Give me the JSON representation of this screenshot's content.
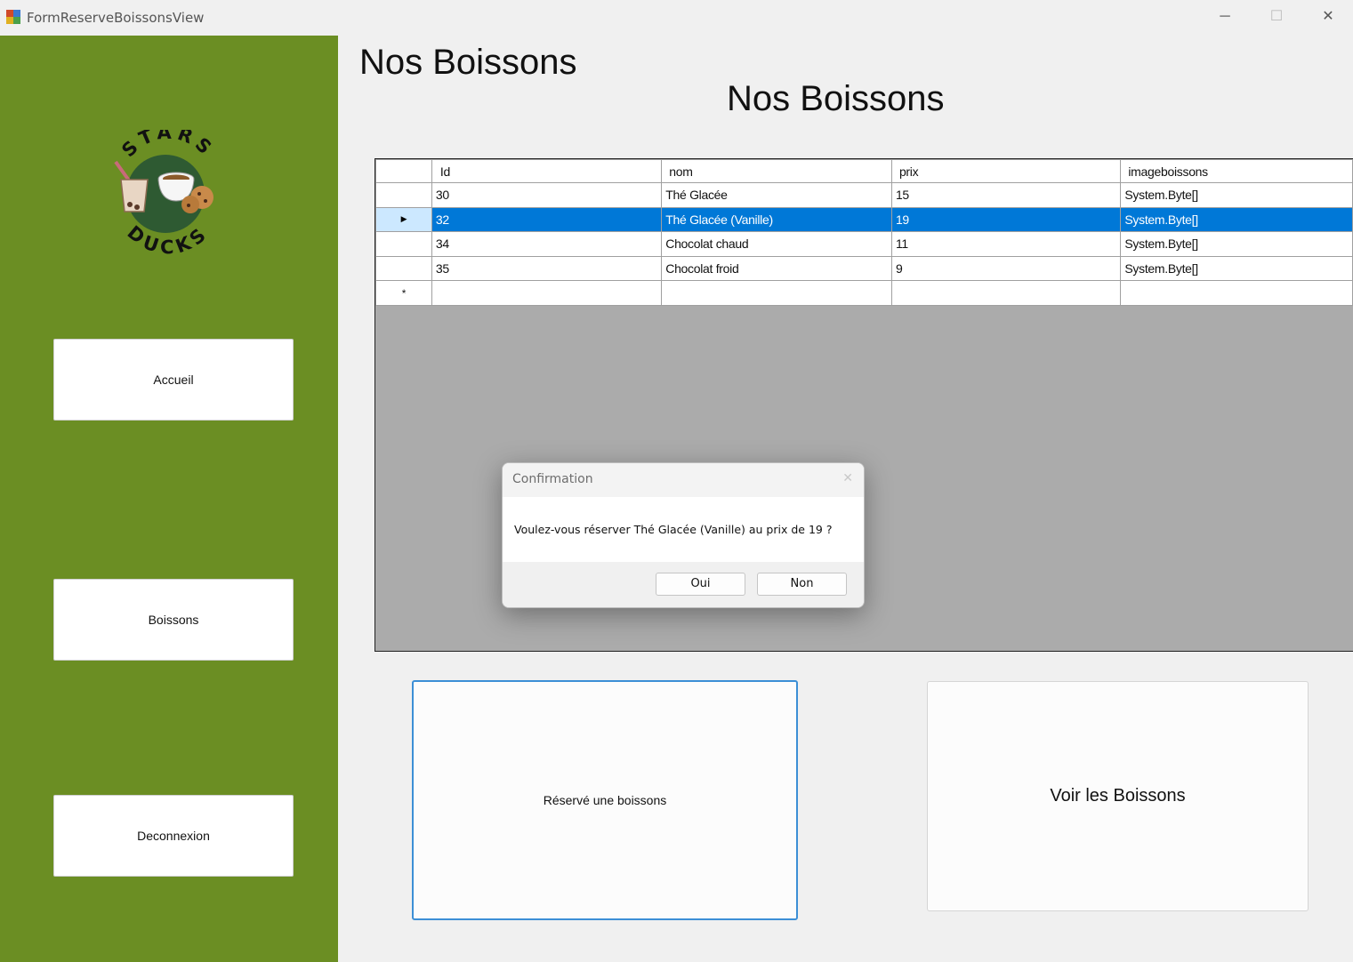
{
  "window": {
    "title": "FormReserveBoissonsView",
    "controls": {
      "minimize": "─",
      "maximize": "☐",
      "close": "✕"
    }
  },
  "sidebar": {
    "logo_top_text": "STARS",
    "logo_bottom_text": "DUCKS",
    "buttons": {
      "accueil": "Accueil",
      "boissons": "Boissons",
      "deconnexion": "Deconnexion"
    },
    "color": "#6b8e23"
  },
  "headings": {
    "left": "Nos Boissons",
    "center": "Nos Boissons"
  },
  "grid": {
    "columns": [
      "Id",
      "nom",
      "prix",
      "imageboissons"
    ],
    "rows": [
      {
        "id": "30",
        "nom": "Thé Glacée",
        "prix": "15",
        "image": "System.Byte[]"
      },
      {
        "id": "32",
        "nom": "Thé Glacée (Vanille)",
        "prix": "19",
        "image": "System.Byte[]"
      },
      {
        "id": "34",
        "nom": "Chocolat chaud",
        "prix": "11",
        "image": "System.Byte[]"
      },
      {
        "id": "35",
        "nom": "Chocolat froid",
        "prix": "9",
        "image": "System.Byte[]"
      }
    ],
    "selected_row_marker": "▶",
    "new_row_marker": "*",
    "selection_color": "#0078d7"
  },
  "dialog": {
    "title": "Confirmation",
    "close": "✕",
    "message": "Voulez-vous réserver Thé Glacée (Vanille) au prix de 19 ?",
    "yes": "Oui",
    "no": "Non"
  },
  "actions": {
    "reserve": "Réservé une boissons",
    "view": "Voir les Boissons"
  }
}
